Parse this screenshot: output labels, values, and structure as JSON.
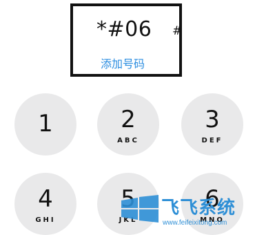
{
  "display": {
    "dialed_number": "*#06",
    "trailing_symbol": "#",
    "add_number_link": "添加号码"
  },
  "keypad": {
    "keys": [
      {
        "digit": "1",
        "letters": ""
      },
      {
        "digit": "2",
        "letters": "ABC"
      },
      {
        "digit": "3",
        "letters": "DEF"
      },
      {
        "digit": "4",
        "letters": "GHI"
      },
      {
        "digit": "5",
        "letters": "JKL"
      },
      {
        "digit": "6",
        "letters": "MNO"
      }
    ]
  },
  "watermark": {
    "title": "飞飞系统",
    "url": "www.feifeixitong.com"
  },
  "colors": {
    "link": "#2b8de0",
    "key_background": "#e9e9ea",
    "border": "#111111",
    "watermark": "#2e8fd6"
  }
}
